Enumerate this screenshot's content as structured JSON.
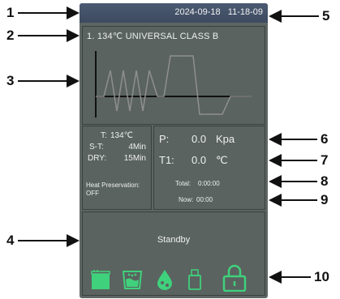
{
  "callouts": [
    "1",
    "2",
    "3",
    "4",
    "5",
    "6",
    "7",
    "8",
    "9",
    "10"
  ],
  "header": {
    "date": "2024-09-18",
    "time": "11-18-09"
  },
  "program": {
    "title": "1. 134℃ UNIVERSAL CLASS B"
  },
  "params": {
    "temp_label": "T:",
    "temp_value": "134℃",
    "st_label": "S-T:",
    "st_value": "4Min",
    "dry_label": "DRY:",
    "dry_value": "15Min",
    "heat_label": "Heat Preservation:",
    "heat_value": "OFF"
  },
  "readings": {
    "p_label": "P:",
    "p_value": "0.0",
    "p_unit": "Kpa",
    "t1_label": "T1:",
    "t1_value": "0.0",
    "t1_unit": "℃",
    "total_label": "Total:",
    "total_value": "0:00:00",
    "now_label": "Now:",
    "now_value": "00:00"
  },
  "status": {
    "text": "Standby"
  },
  "icons": [
    "chamber-icon",
    "water-tank-icon",
    "drain-icon",
    "usb-icon",
    "lock-icon"
  ],
  "colors": {
    "screen_bg": "#5d6662",
    "accent_green": "#3fd17b",
    "topbar": "#3d4a60"
  }
}
